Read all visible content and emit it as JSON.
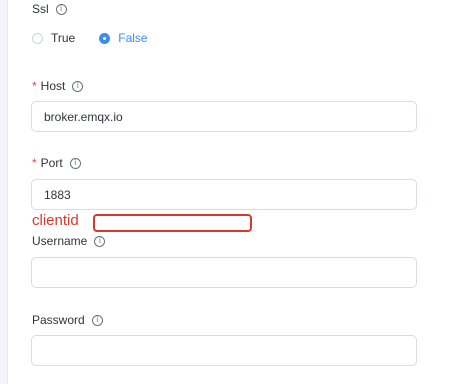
{
  "ssl": {
    "label": "Ssl",
    "info_icon": "info-circle-icon",
    "options": [
      {
        "label": "True",
        "checked": false
      },
      {
        "label": "False",
        "checked": true
      }
    ]
  },
  "host": {
    "required_mark": "*",
    "label": "Host",
    "info_icon": "info-circle-icon",
    "value": "broker.emqx.io"
  },
  "port": {
    "required_mark": "*",
    "label": "Port",
    "info_icon": "info-circle-icon",
    "value": "1883"
  },
  "annotation": {
    "text": "clientid",
    "color": "#d8382c"
  },
  "username": {
    "label": "Username",
    "info_icon": "info-circle-icon",
    "value": ""
  },
  "password": {
    "label": "Password",
    "info_icon": "info-circle-icon",
    "value": ""
  },
  "colors": {
    "accent": "#3d8cf0",
    "required": "#e0484d",
    "text": "#30343c",
    "border": "#d9dce2"
  }
}
